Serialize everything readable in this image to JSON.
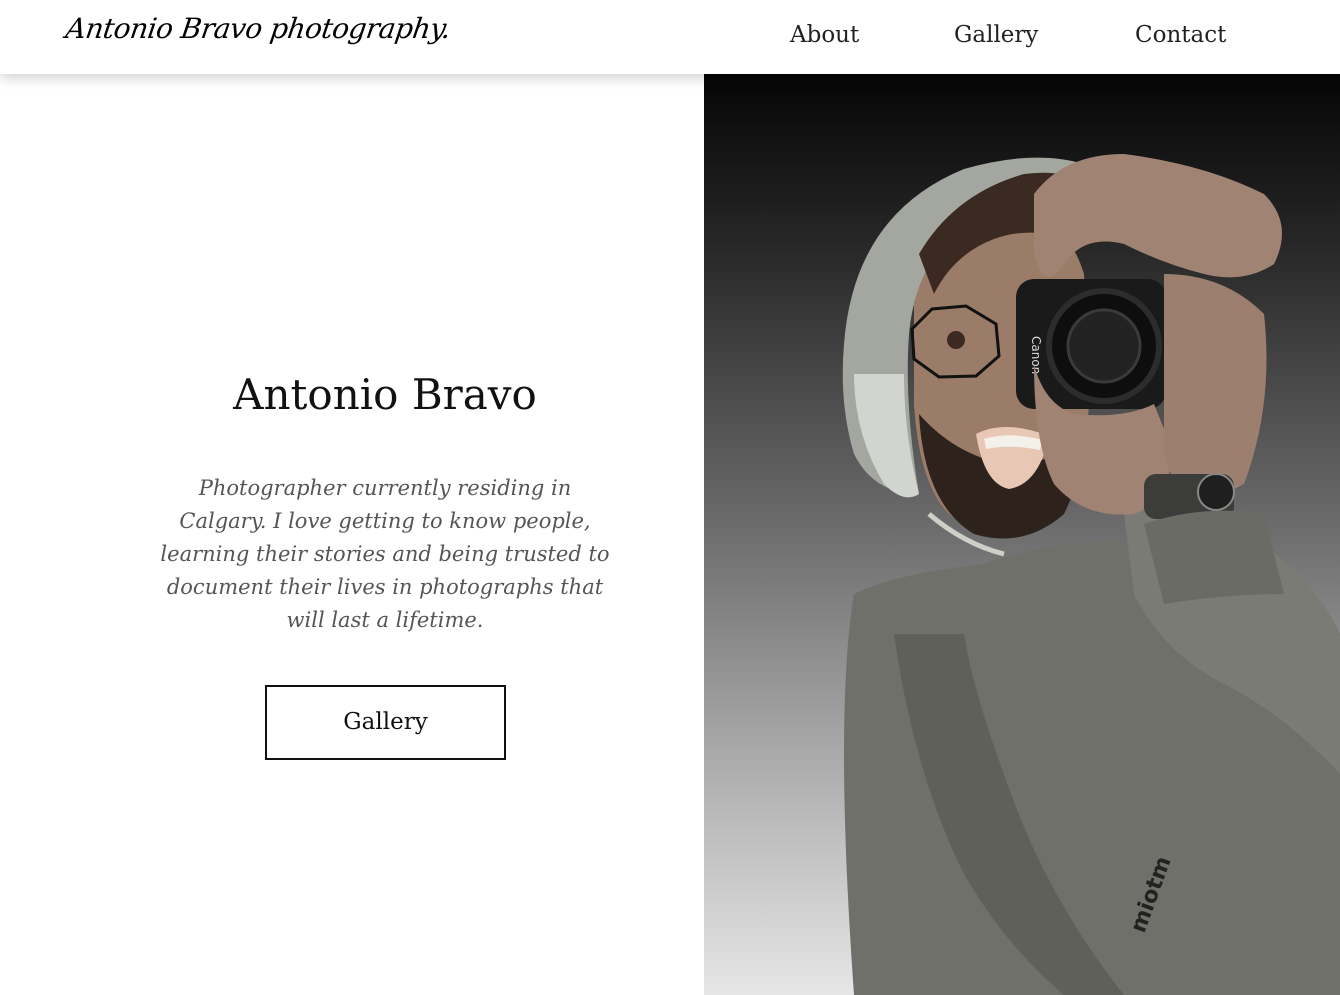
{
  "header": {
    "logo_text": "Antonio Bravo photography.",
    "nav": [
      {
        "label": "About"
      },
      {
        "label": "Gallery"
      },
      {
        "label": "Contact"
      }
    ]
  },
  "hero": {
    "name": "Antonio Bravo",
    "bio": "Photographer currently residing in Calgary. I love getting to know people, learning their stories and being trusted to document their lives in photographs that will last a lifetime.",
    "button_label": "Gallery"
  },
  "photo": {
    "camera_brand": "Canon",
    "sweater_text": "miotm"
  },
  "colors": {
    "text_primary": "#111111",
    "text_muted": "#555555",
    "background": "#ffffff"
  }
}
